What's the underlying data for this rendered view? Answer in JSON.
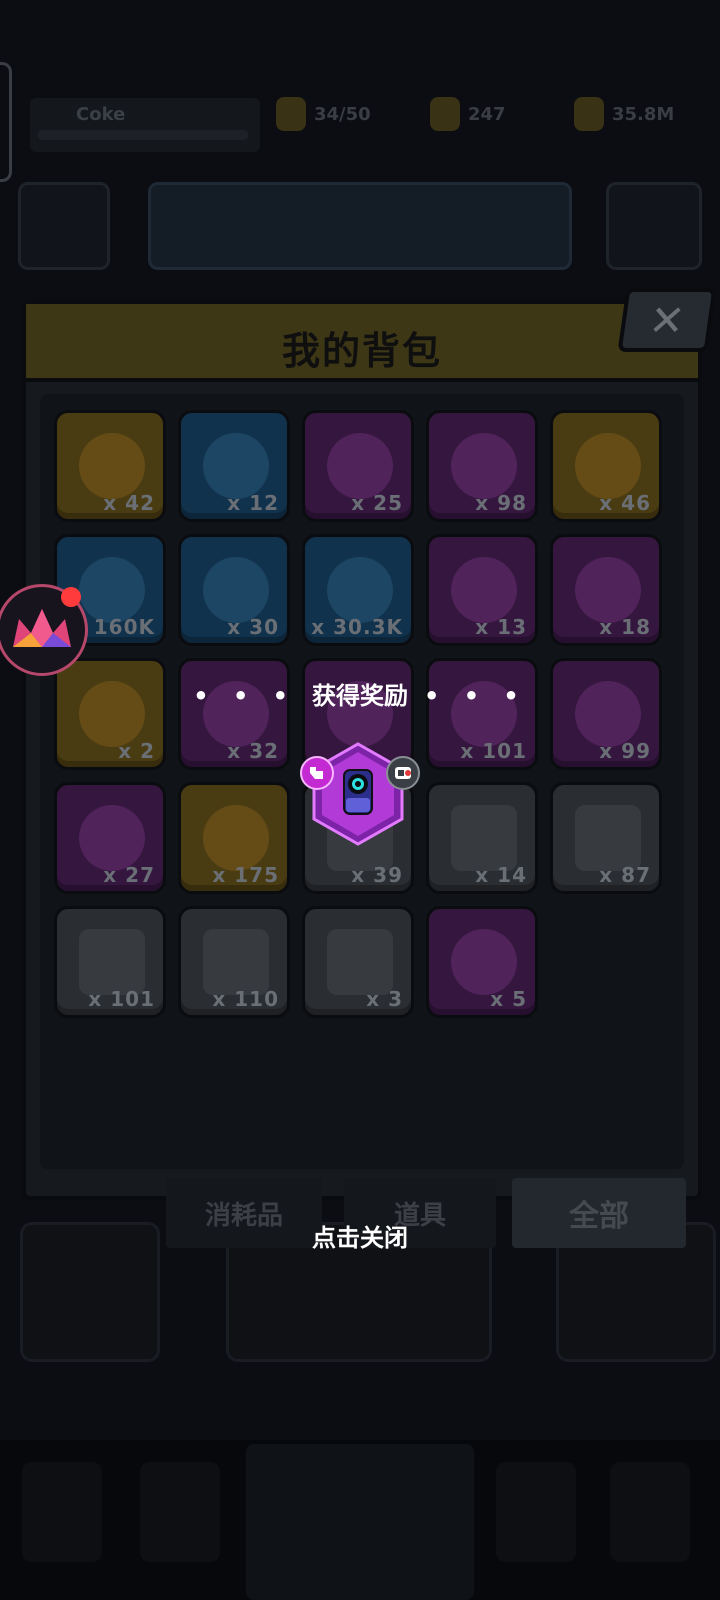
{
  "panel": {
    "title": "我的背包",
    "close_label": "✕"
  },
  "background": {
    "player_name": "Coke",
    "resources": [
      "34/50",
      "247",
      "35.8M"
    ]
  },
  "inventory": [
    {
      "color": "gold",
      "icon": "crossed-swords-coin-icon",
      "qty": "x 42"
    },
    {
      "color": "blue",
      "icon": "silver-key-icon",
      "qty": "x 12"
    },
    {
      "color": "purple",
      "icon": "gold-key-icon",
      "qty": "x 25"
    },
    {
      "color": "purple",
      "icon": "heart-coin-icon",
      "qty": "x 98"
    },
    {
      "color": "gold",
      "icon": "square-key-icon",
      "qty": "x 46"
    },
    {
      "color": "blue",
      "icon": "flame-drop-icon",
      "qty": "x 160K"
    },
    {
      "color": "blue",
      "icon": "gold-coin-icon",
      "qty": "x 30"
    },
    {
      "color": "blue",
      "icon": "bear-coin-icon",
      "qty": "x 30.3K"
    },
    {
      "color": "purple",
      "icon": "ticket-icon",
      "qty": "x 13"
    },
    {
      "color": "purple",
      "icon": "round-key-icon",
      "qty": "x 18"
    },
    {
      "color": "gold",
      "icon": "potion-bottle-icon",
      "qty": "x 2"
    },
    {
      "color": "purple",
      "icon": "puzzle-piece-icon",
      "qty": "x 32"
    },
    {
      "color": "purple",
      "icon": "puzzle-piece-icon",
      "qty": ""
    },
    {
      "color": "purple",
      "icon": "puzzle-piece-icon",
      "qty": "x 101"
    },
    {
      "color": "purple",
      "icon": "puzzle-piece-icon",
      "qty": "x 99"
    },
    {
      "color": "purple",
      "icon": "puzzle-piece-icon",
      "qty": "x 27"
    },
    {
      "color": "gold",
      "icon": "treasure-chest-icon",
      "qty": "x 175"
    },
    {
      "color": "grey",
      "icon": "blueprint-icon",
      "qty": "x 39"
    },
    {
      "color": "grey",
      "icon": "shirt-blueprint-icon",
      "qty": "x 14"
    },
    {
      "color": "grey",
      "icon": "collar-blueprint-icon",
      "qty": "x 87"
    },
    {
      "color": "grey",
      "icon": "belt-blueprint-icon",
      "qty": "x 101"
    },
    {
      "color": "grey",
      "icon": "glove-blueprint-icon",
      "qty": "x 110"
    },
    {
      "color": "grey",
      "icon": "document-blueprint-icon",
      "qty": "x 3"
    },
    {
      "color": "purple",
      "icon": "gear-box-icon",
      "qty": "x 5"
    }
  ],
  "tabs": [
    "消耗品",
    "道具",
    "全部"
  ],
  "reward": {
    "title": "获得奖励",
    "dots": "• • •",
    "tap_to_close": "点击关闭"
  },
  "colors": {
    "reward_hex": "#b23ad6",
    "reward_hex_light": "#d45cf0",
    "panel_header": "#3e3716",
    "notification": "#ff3b3b"
  }
}
